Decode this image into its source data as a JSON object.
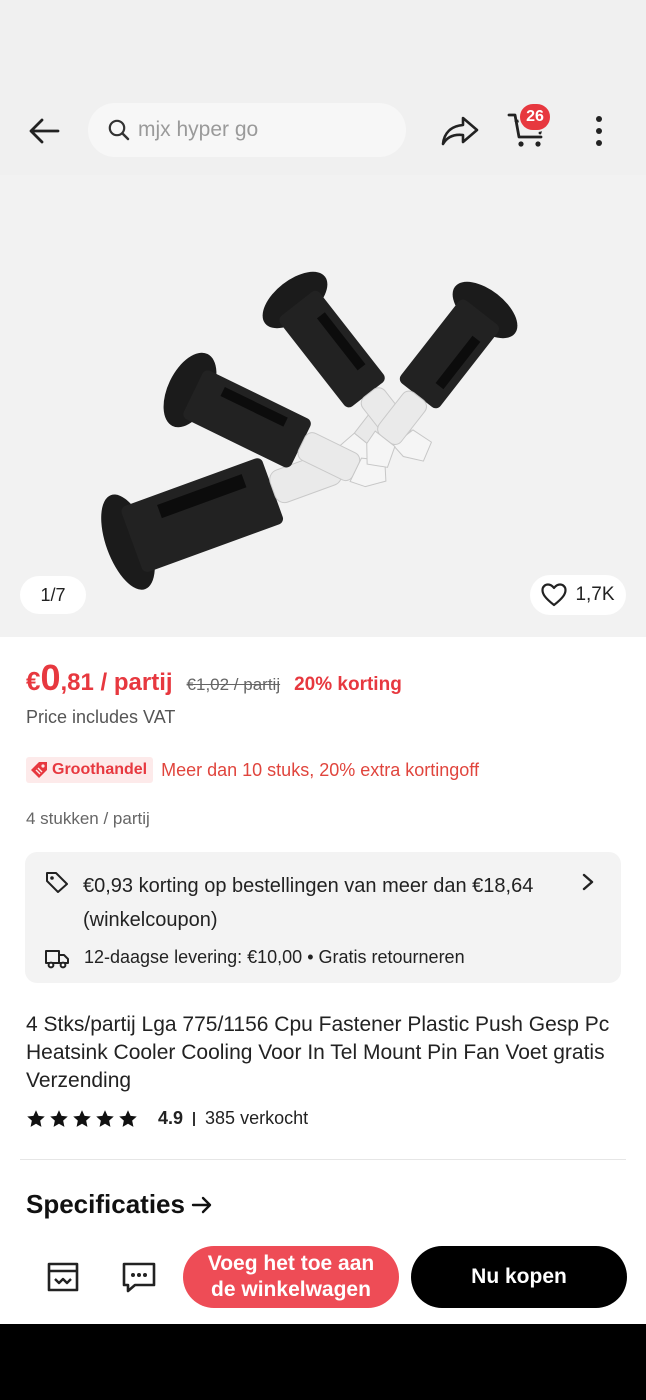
{
  "header": {
    "search_placeholder": "mjx hyper go",
    "cart_count": "26"
  },
  "gallery": {
    "counter": "1/7",
    "wishlist_count": "1,7K"
  },
  "price": {
    "currency": "€",
    "integer": "0",
    "decimal_unit": ",81 / partij",
    "original": "€1,02 / partij",
    "discount": "20% korting",
    "vat_note": "Price includes VAT"
  },
  "wholesale": {
    "badge": "Groothandel",
    "text": "Meer dan 10 stuks, 20% extra kortingoff"
  },
  "units": "4 stukken / partij",
  "coupon": {
    "text": "€0,93 korting op bestellingen van meer dan €18,64 (winkelcoupon)",
    "delivery": "12-daagse levering: €10,00",
    "bullet": "•",
    "returns": "Gratis retourneren"
  },
  "product": {
    "title": "4 Stks/partij Lga 775/1156 Cpu Fastener Plastic Push Gesp Pc Heatsink Cooler Cooling Voor In Tel Mount Pin Fan Voet gratis Verzending",
    "rating": "4.9",
    "stars": 5,
    "sold": "385 verkocht"
  },
  "specs_label": "Specificaties",
  "bottom": {
    "add_to_cart": "Voeg het toe aan de winkelwagen",
    "buy_now": "Nu kopen"
  },
  "colors": {
    "accent": "#e7383f",
    "add_to_cart_bg": "#ee4c56",
    "buy_bg": "#000000"
  }
}
